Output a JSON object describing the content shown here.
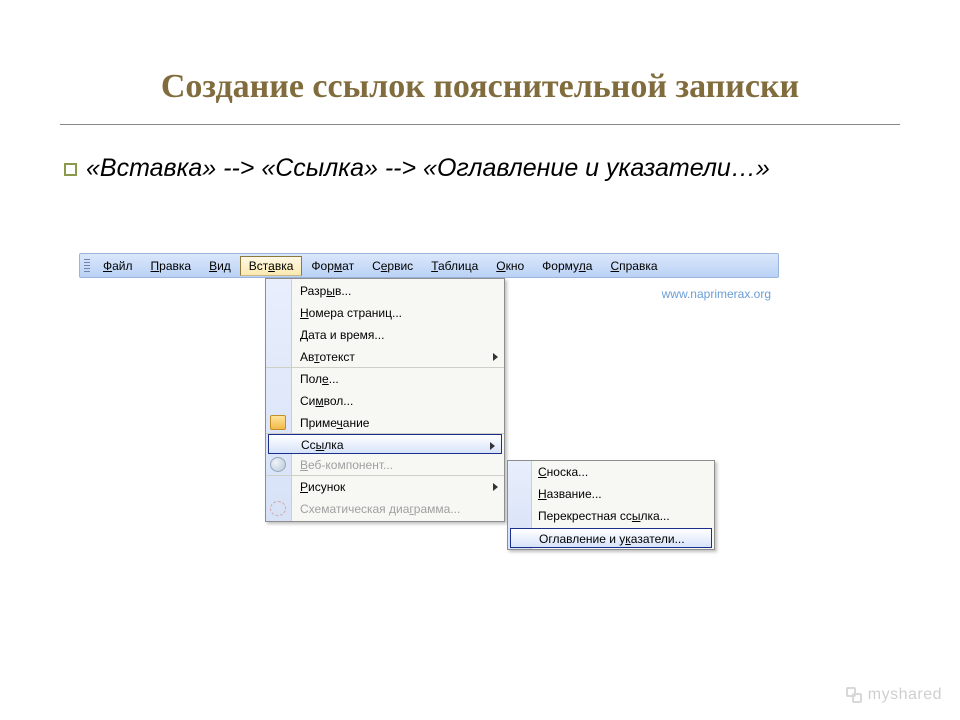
{
  "slide": {
    "title": "Создание ссылок пояснительной записки",
    "instruction": "«Вставка» --> «Ссылка» --> «Оглавление и указатели…»"
  },
  "watermark": "www.naprimerax.org",
  "footer_brand": "myshared",
  "menubar": {
    "items": [
      {
        "label": "Файл",
        "hot": "Ф"
      },
      {
        "label": "Правка",
        "hot": "П"
      },
      {
        "label": "Вид",
        "hot": "В"
      },
      {
        "label": "Вставка",
        "hot": "а",
        "active": true
      },
      {
        "label": "Формат",
        "hot": "м"
      },
      {
        "label": "Сервис",
        "hot": "е"
      },
      {
        "label": "Таблица",
        "hot": "Т"
      },
      {
        "label": "Окно",
        "hot": "О"
      },
      {
        "label": "Формула",
        "hot": "л"
      },
      {
        "label": "Справка",
        "hot": "С"
      }
    ]
  },
  "dropdown": {
    "items": [
      {
        "label": "Разрыв...",
        "hot": "ы"
      },
      {
        "label": "Номера страниц...",
        "hot": "Н"
      },
      {
        "label": "Дата и время...",
        "hot": "Д"
      },
      {
        "label": "Автотекст",
        "hot": "т",
        "submenu": true,
        "sep_after": true
      },
      {
        "label": "Поле...",
        "hot": "е"
      },
      {
        "label": "Символ...",
        "hot": "м"
      },
      {
        "label": "Примечание",
        "hot": "ч",
        "icon": "folder",
        "sep_after": true
      },
      {
        "label": "Ссылка",
        "hot": "ы",
        "submenu": true,
        "selected": true,
        "sep_after": true
      },
      {
        "label": "Веб-компонент...",
        "hot": "В",
        "disabled": true,
        "icon": "web",
        "sep_after": true
      },
      {
        "label": "Рисунок",
        "hot": "Р",
        "submenu": true
      },
      {
        "label": "Схематическая диаграмма...",
        "hot": "г",
        "disabled": true,
        "icon": "org"
      }
    ]
  },
  "submenu": {
    "items": [
      {
        "label": "Сноска...",
        "hot": "С"
      },
      {
        "label": "Название...",
        "hot": "Н"
      },
      {
        "label": "Перекрестная ссылка...",
        "hot": "ы"
      },
      {
        "label": "Оглавление и указатели...",
        "hot": "к",
        "selected": true
      }
    ]
  }
}
